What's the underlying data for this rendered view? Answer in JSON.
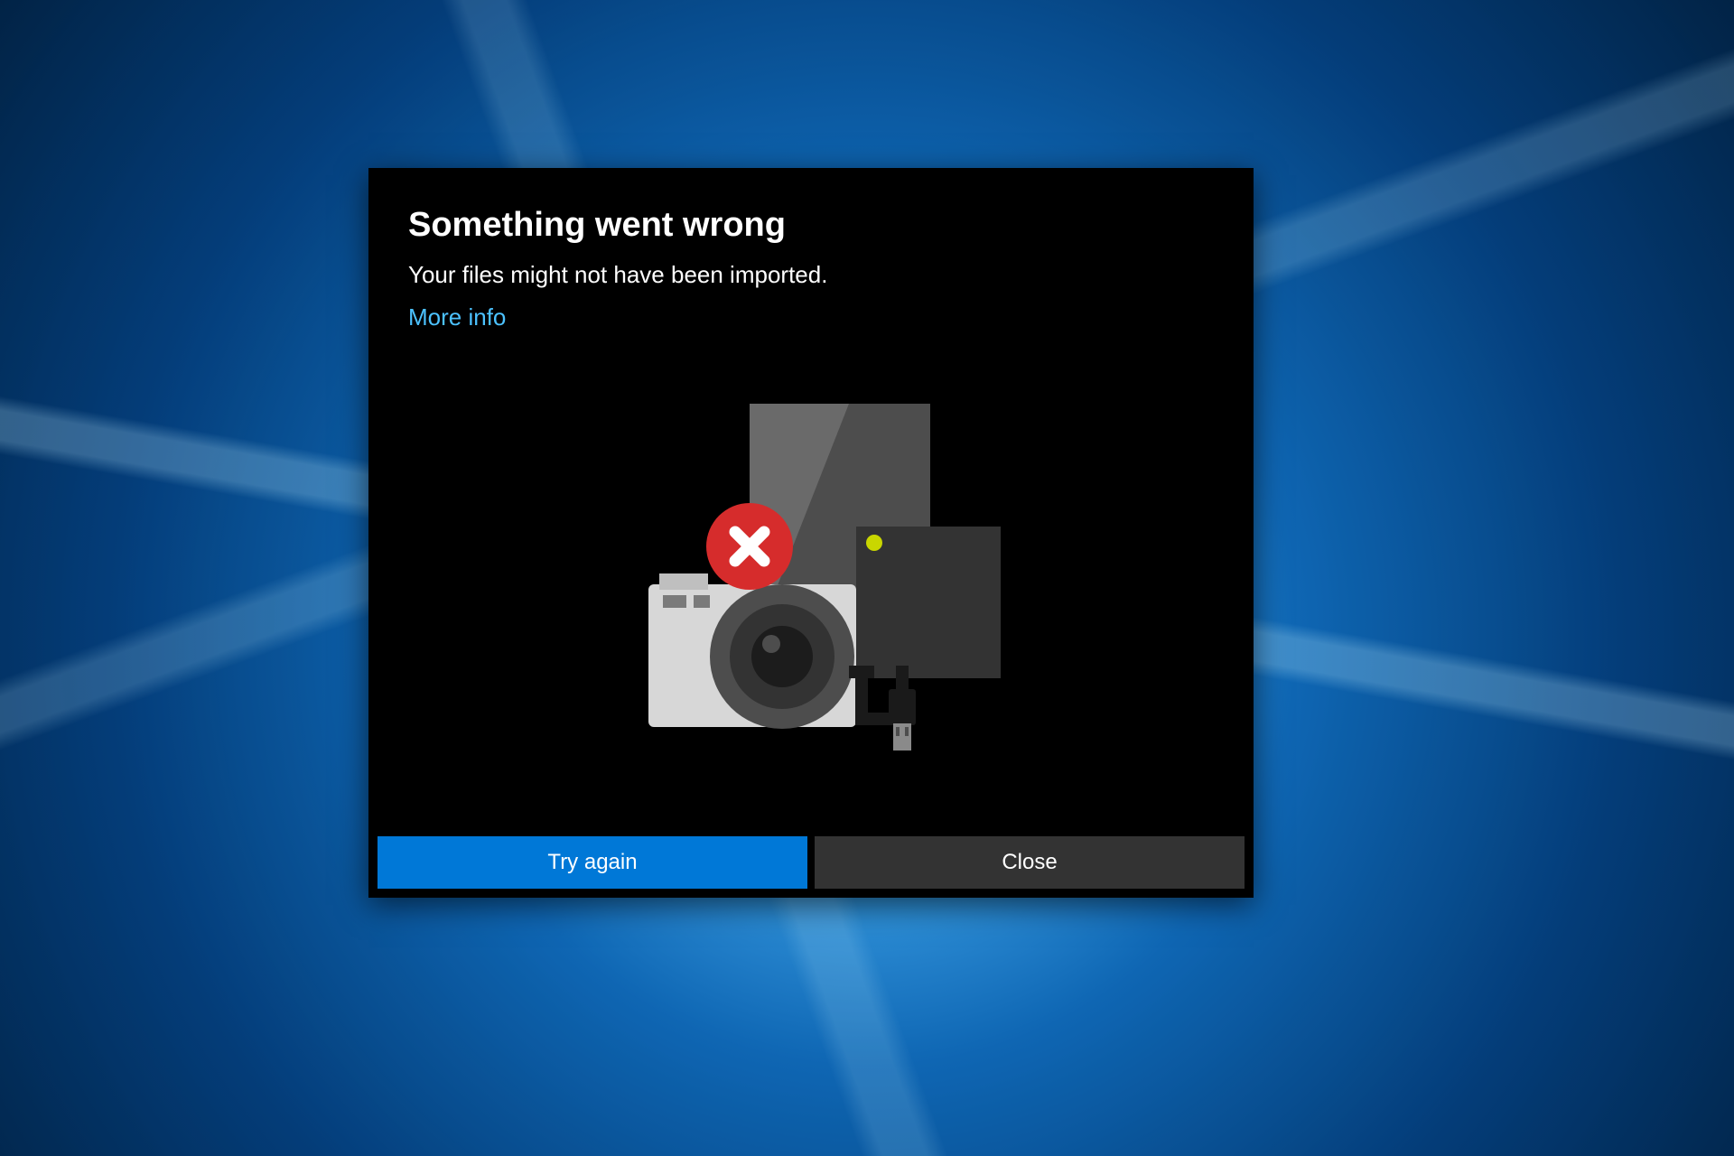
{
  "dialog": {
    "title": "Something went wrong",
    "message": "Your files might not have been imported.",
    "more_info_label": "More info",
    "buttons": {
      "primary": "Try again",
      "secondary": "Close"
    }
  },
  "colors": {
    "accent": "#0078d7",
    "link": "#4cc2ff",
    "error": "#d62c2c",
    "indicator": "#c9d600"
  }
}
